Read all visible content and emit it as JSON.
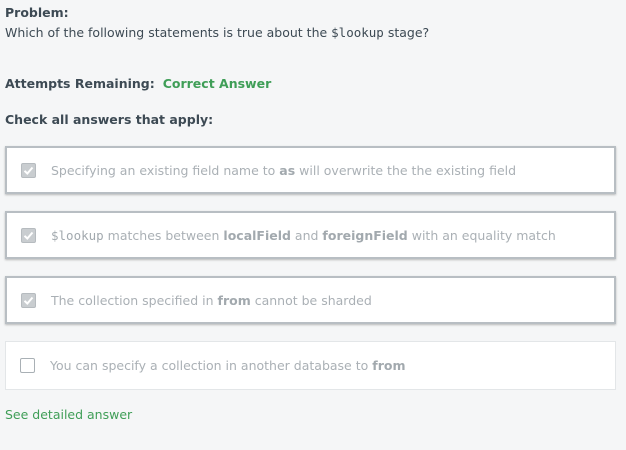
{
  "problem": {
    "label": "Problem:",
    "question_before": "Which of the following statements is true about the ",
    "question_code": "$lookup",
    "question_after": " stage?"
  },
  "attempts": {
    "label": "Attempts Remaining:",
    "value": "Correct Answer",
    "value_color": "#3f9e57"
  },
  "instructions": "Check all answers that apply:",
  "options": [
    {
      "checked": true,
      "parts": [
        "Specifying an existing field name to ",
        "as",
        " will overwrite the the existing field"
      ]
    },
    {
      "checked": true,
      "code": "$lookup",
      "parts": [
        " matches between ",
        "localField",
        " and ",
        "foreignField",
        " with an equality match"
      ]
    },
    {
      "checked": true,
      "parts": [
        "The collection specified in ",
        "from",
        " cannot be sharded"
      ]
    },
    {
      "checked": false,
      "parts": [
        "You can specify a collection in another database to ",
        "from"
      ]
    }
  ],
  "see_answer_link": "See detailed answer",
  "colors": {
    "background": "#f5f6f7",
    "accent_green": "#3f9e57",
    "disabled_text": "#aab0b5"
  }
}
